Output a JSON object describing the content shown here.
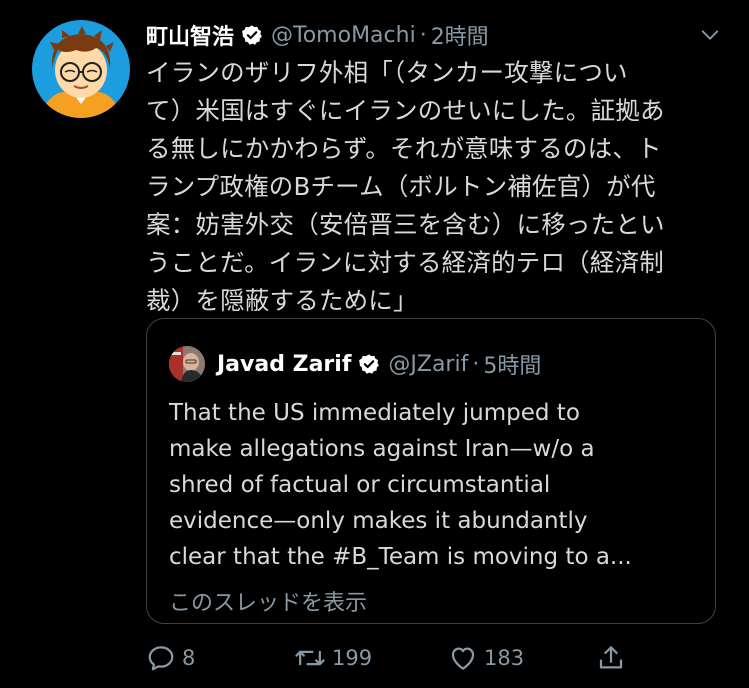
{
  "tweet": {
    "display_name": "町山智浩",
    "handle": "@TomoMachi",
    "separator": "·",
    "time": "2時間",
    "text": "イランのザリフ外相「（タンカー攻撃につい\nて）米国はすぐにイランのせいにした。証拠あ\nる無しにかかわらず。それが意味するのは、ト\nランプ政権のBチーム（ボルトン補佐官）が代\n案：妨害外交（安倍晋三を含む）に移ったとい\nうことだ。イランに対する経済的テロ（経済制\n裁）を隠蔽するために」",
    "verified_icon": "verified-badge-icon",
    "menu_icon": "chevron-down-icon"
  },
  "quote": {
    "display_name": "Javad Zarif",
    "handle": "@JZarif",
    "separator": "·",
    "time": "5時間",
    "text": "That the US immediately jumped to\nmake allegations against Iran—w/o a\nshred of factual or circumstantial\nevidence—only makes it abundantly\nclear that the #B_Team is moving to a...",
    "show_thread": "このスレッドを表示"
  },
  "actions": {
    "reply_count": "8",
    "retweet_count": "199",
    "like_count": "183"
  },
  "colors": {
    "background": "#000000",
    "text": "#d9d9d9",
    "secondary": "#8899a6",
    "verified": "#ffffff",
    "card_border": "#3d4448",
    "avatar_bg": "#1da1f2"
  }
}
